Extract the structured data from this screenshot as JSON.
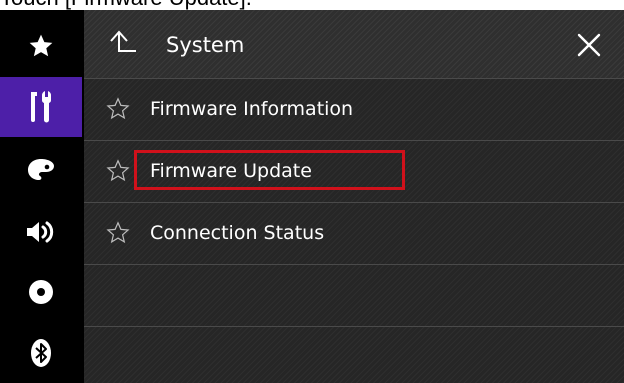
{
  "caption": "Touch [Firmware Update].",
  "sidebar": {
    "items": [
      {
        "icon": "star-icon",
        "active": false
      },
      {
        "icon": "tools-icon",
        "active": true
      },
      {
        "icon": "palette-icon",
        "active": false
      },
      {
        "icon": "speaker-icon",
        "active": false
      },
      {
        "icon": "disc-icon",
        "active": false
      },
      {
        "icon": "bluetooth-icon",
        "active": false
      }
    ]
  },
  "header": {
    "title": "System",
    "back_icon": "back-arrow-icon",
    "close_icon": "close-icon"
  },
  "menu": {
    "items": [
      {
        "label": "Firmware Information",
        "icon": "star-outline-icon"
      },
      {
        "label": "Firmware Update",
        "icon": "star-outline-icon",
        "highlighted": true
      },
      {
        "label": "Connection Status",
        "icon": "star-outline-icon"
      }
    ]
  },
  "colors": {
    "active_sidebar": "#4d1fa8",
    "highlight_border": "#d0111b",
    "background": "#262626"
  }
}
